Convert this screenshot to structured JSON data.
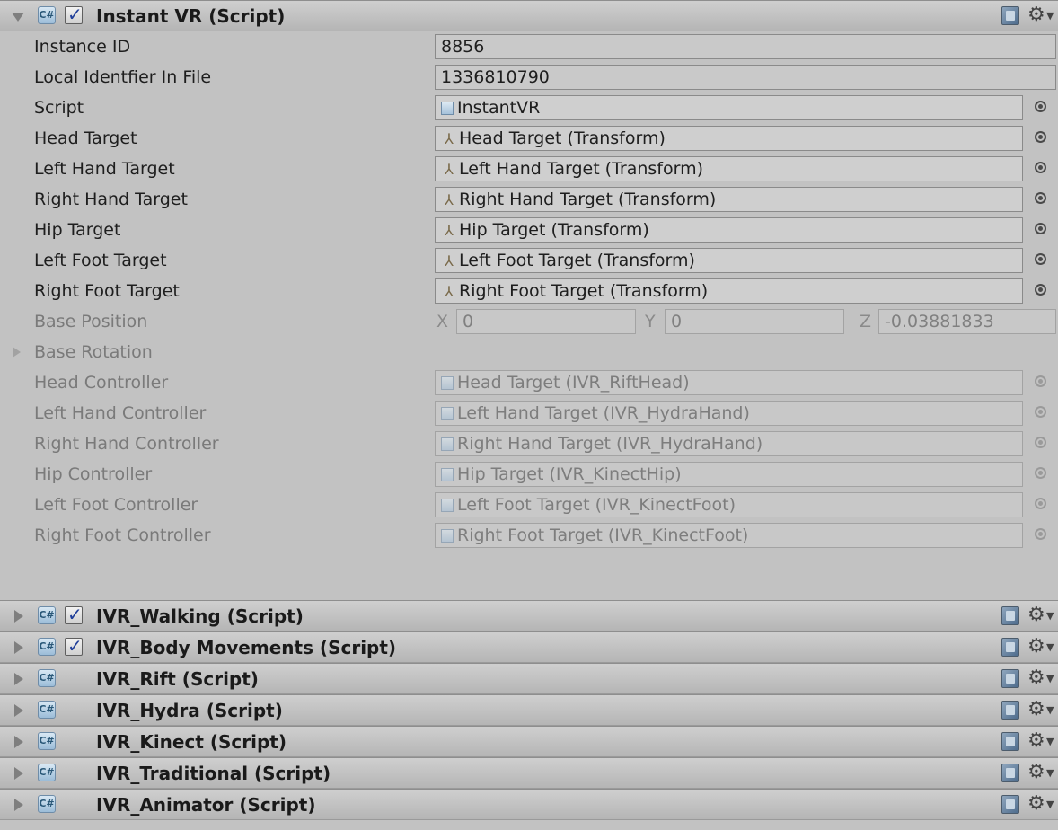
{
  "main_component": {
    "title": "Instant VR (Script)",
    "enabled": true,
    "properties": [
      {
        "label": "Instance ID",
        "kind": "text",
        "value": "8856",
        "disabled": false
      },
      {
        "label": "Local Identfier In File",
        "kind": "text",
        "value": "1336810790",
        "disabled": false
      },
      {
        "label": "Script",
        "kind": "script",
        "value": "InstantVR",
        "disabled": false
      },
      {
        "label": "Head Target",
        "kind": "transform",
        "value": "Head Target (Transform)",
        "disabled": false
      },
      {
        "label": "Left Hand Target",
        "kind": "transform",
        "value": "Left Hand Target (Transform)",
        "disabled": false
      },
      {
        "label": "Right Hand Target",
        "kind": "transform",
        "value": "Right Hand Target (Transform)",
        "disabled": false
      },
      {
        "label": "Hip Target",
        "kind": "transform",
        "value": "Hip Target (Transform)",
        "disabled": false
      },
      {
        "label": "Left Foot Target",
        "kind": "transform",
        "value": "Left Foot Target (Transform)",
        "disabled": false
      },
      {
        "label": "Right Foot Target",
        "kind": "transform",
        "value": "Right Foot Target (Transform)",
        "disabled": false
      }
    ],
    "base_position": {
      "label": "Base Position",
      "x_label": "X",
      "x": "0",
      "y_label": "Y",
      "y": "0",
      "z_label": "Z",
      "z": "-0.03881833"
    },
    "base_rotation": {
      "label": "Base Rotation"
    },
    "controllers": [
      {
        "label": "Head Controller",
        "value": "Head Target (IVR_RiftHead)"
      },
      {
        "label": "Left Hand Controller",
        "value": "Left Hand Target (IVR_HydraHand)"
      },
      {
        "label": "Right Hand Controller",
        "value": "Right Hand Target (IVR_HydraHand)"
      },
      {
        "label": "Hip Controller",
        "value": "Hip Target (IVR_KinectHip)"
      },
      {
        "label": "Left Foot Controller",
        "value": "Left Foot Target (IVR_KinectFoot)"
      },
      {
        "label": "Right Foot Controller",
        "value": "Right Foot Target (IVR_KinectFoot)"
      }
    ]
  },
  "collapsed_components": [
    {
      "title": "IVR_Walking (Script)",
      "has_checkbox": true,
      "enabled": true
    },
    {
      "title": "IVR_Body Movements (Script)",
      "has_checkbox": true,
      "enabled": true
    },
    {
      "title": "IVR_Rift (Script)",
      "has_checkbox": false
    },
    {
      "title": "IVR_Hydra (Script)",
      "has_checkbox": false
    },
    {
      "title": "IVR_Kinect (Script)",
      "has_checkbox": false
    },
    {
      "title": "IVR_Traditional (Script)",
      "has_checkbox": false
    },
    {
      "title": "IVR_Animator (Script)",
      "has_checkbox": false
    }
  ],
  "icons": {
    "component_icon": "csharp-script-icon",
    "help_icon": "book-icon",
    "settings_icon": "gear-icon",
    "transform_icon": "transform-axes-icon",
    "object_picker_icon": "object-picker-icon"
  }
}
